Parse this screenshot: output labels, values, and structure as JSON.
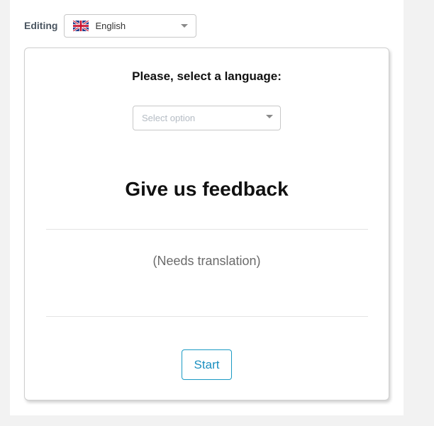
{
  "editing": {
    "label": "Editing",
    "language_value": "English",
    "flag_icon": "uk-flag-icon"
  },
  "form": {
    "prompt": "Please, select a language:",
    "select_placeholder": "Select option",
    "heading": "Give us feedback",
    "subtext": "(Needs translation)",
    "start_label": "Start"
  },
  "colors": {
    "accent": "#1a8fc0",
    "background": "#f2f2f2"
  }
}
